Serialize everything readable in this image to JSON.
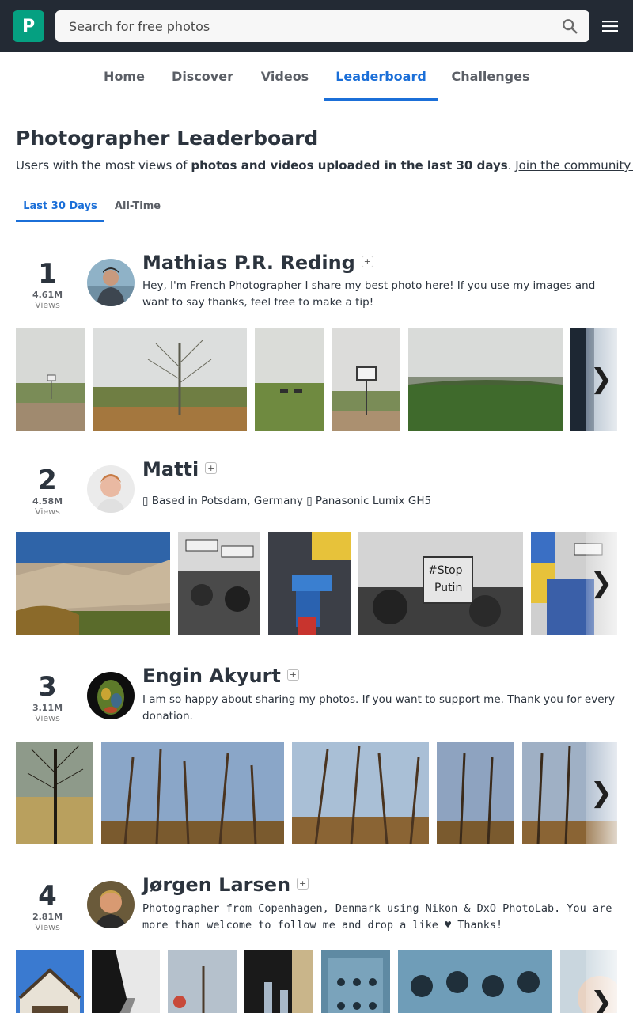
{
  "header": {
    "logo_letter": "P",
    "search_placeholder": "Search for free photos"
  },
  "nav": {
    "items": [
      "Home",
      "Discover",
      "Videos",
      "Leaderboard",
      "Challenges"
    ],
    "active": "Leaderboard"
  },
  "page": {
    "title": "Photographer Leaderboard",
    "subtitle_prefix": "Users with the most views of ",
    "subtitle_bold": "photos and videos uploaded in the last 30 days",
    "subtitle_suffix": ". ",
    "subtitle_link": "Join the community →"
  },
  "tabs": {
    "last30": "Last 30 Days",
    "alltime": "All-Time",
    "active": "Last 30 Days"
  },
  "views_label": "Views",
  "follow_label": "+",
  "next_label": "❯",
  "photographers": [
    {
      "rank": "1",
      "views": "4.61M",
      "name": "Mathias P.R. Reding",
      "bio": "Hey, I'm French Photographer I share my best photo here! If you use my images and want to say thanks, feel free to make a tip!"
    },
    {
      "rank": "2",
      "views": "4.58M",
      "name": "Matti",
      "bio": "▯ Based in Potsdam, Germany ▯ Panasonic Lumix GH5"
    },
    {
      "rank": "3",
      "views": "3.11M",
      "name": "Engin Akyurt",
      "bio": "I am so happy about sharing my photos. If you want to support me. Thank you for every donation."
    },
    {
      "rank": "4",
      "views": "2.81M",
      "name": "Jørgen Larsen",
      "bio": "Photographer from Copenhagen, Denmark using Nikon & DxO PhotoLab. You are more than welcome to follow me and drop a like ♥ Thanks!"
    }
  ],
  "colors": {
    "topbar": "#232a34",
    "brand": "#05a081",
    "accent": "#1b6fd8",
    "text": "#2c343e"
  }
}
